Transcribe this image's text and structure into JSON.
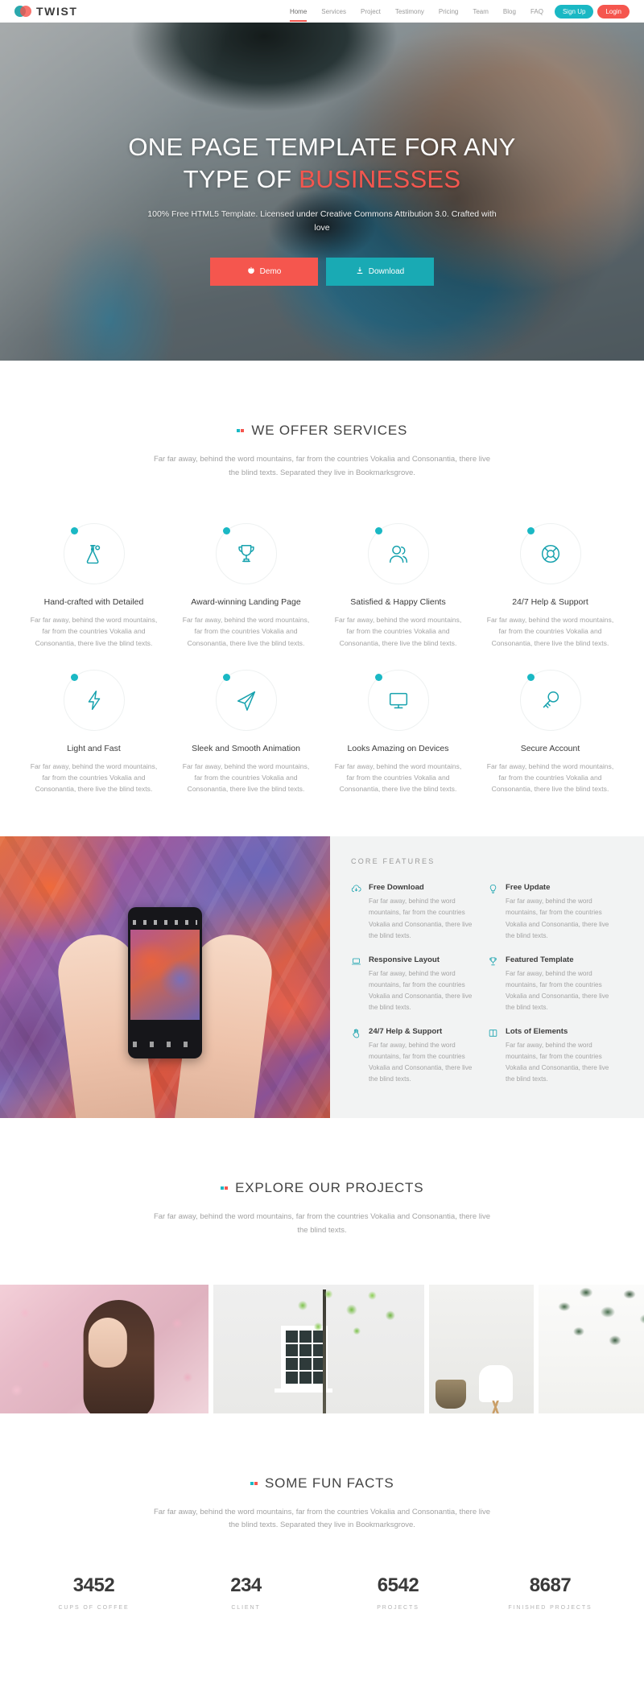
{
  "brand": {
    "name": "TWIST",
    "mark": "twist-logo-icon"
  },
  "nav": {
    "links": [
      {
        "label": "Home",
        "active": true
      },
      {
        "label": "Services",
        "active": false
      },
      {
        "label": "Project",
        "active": false
      },
      {
        "label": "Testimony",
        "active": false
      },
      {
        "label": "Pricing",
        "active": false
      },
      {
        "label": "Team",
        "active": false
      },
      {
        "label": "Blog",
        "active": false
      },
      {
        "label": "FAQ",
        "active": false
      }
    ],
    "signup_label": "Sign Up",
    "login_label": "Login"
  },
  "hero": {
    "title_line1": "ONE PAGE TEMPLATE FOR ANY",
    "title_line2_plain": "TYPE OF ",
    "title_line2_highlight": "BUSINESSES",
    "subtitle": "100% Free HTML5 Template. Licensed under Creative Commons Attribution 3.0. Crafted with love",
    "demo_label": "Demo",
    "download_label": "Download"
  },
  "services_section": {
    "title": "WE OFFER SERVICES",
    "description": "Far far away, behind the word mountains, far from the countries Vokalia and Consonantia, there live the blind texts. Separated they live in Bookmarksgrove.",
    "items": [
      {
        "icon": "flask-icon",
        "title": "Hand-crafted with Detailed",
        "desc": "Far far away, behind the word mountains, far from the countries Vokalia and Consonantia, there live the blind texts."
      },
      {
        "icon": "trophy-icon",
        "title": "Award-winning Landing Page",
        "desc": "Far far away, behind the word mountains, far from the countries Vokalia and Consonantia, there live the blind texts."
      },
      {
        "icon": "users-icon",
        "title": "Satisfied & Happy Clients",
        "desc": "Far far away, behind the word mountains, far from the countries Vokalia and Consonantia, there live the blind texts."
      },
      {
        "icon": "lifebuoy-icon",
        "title": "24/7 Help & Support",
        "desc": "Far far away, behind the word mountains, far from the countries Vokalia and Consonantia, there live the blind texts."
      },
      {
        "icon": "bolt-icon",
        "title": "Light and Fast",
        "desc": "Far far away, behind the word mountains, far from the countries Vokalia and Consonantia, there live the blind texts."
      },
      {
        "icon": "paper-plane-icon",
        "title": "Sleek and Smooth Animation",
        "desc": "Far far away, behind the word mountains, far from the countries Vokalia and Consonantia, there live the blind texts."
      },
      {
        "icon": "monitor-icon",
        "title": "Looks Amazing on Devices",
        "desc": "Far far away, behind the word mountains, far from the countries Vokalia and Consonantia, there live the blind texts."
      },
      {
        "icon": "key-icon",
        "title": "Secure Account",
        "desc": "Far far away, behind the word mountains, far from the countries Vokalia and Consonantia, there live the blind texts."
      }
    ]
  },
  "core_features": {
    "title": "CORE FEATURES",
    "image_alt": "hands-holding-phone-graffiti-photo",
    "items": [
      {
        "icon": "cloud-download-icon",
        "title": "Free Download",
        "desc": "Far far away, behind the word mountains, far from the countries Vokalia and Consonantia, there live the blind texts."
      },
      {
        "icon": "lightbulb-icon",
        "title": "Free Update",
        "desc": "Far far away, behind the word mountains, far from the countries Vokalia and Consonantia, there live the blind texts."
      },
      {
        "icon": "laptop-icon",
        "title": "Responsive Layout",
        "desc": "Far far away, behind the word mountains, far from the countries Vokalia and Consonantia, there live the blind texts."
      },
      {
        "icon": "trophy-icon",
        "title": "Featured Template",
        "desc": "Far far away, behind the word mountains, far from the countries Vokalia and Consonantia, there live the blind texts."
      },
      {
        "icon": "hand-icon",
        "title": "24/7 Help & Support",
        "desc": "Far far away, behind the word mountains, far from the countries Vokalia and Consonantia, there live the blind texts."
      },
      {
        "icon": "columns-icon",
        "title": "Lots of Elements",
        "desc": "Far far away, behind the word mountains, far from the countries Vokalia and Consonantia, there live the blind texts."
      }
    ]
  },
  "projects_section": {
    "title": "EXPLORE OUR PROJECTS",
    "description": "Far far away, behind the word mountains, far from the countries Vokalia and Consonantia, there live the blind texts.",
    "items": [
      {
        "alt": "woman-in-pink-blossoms-photo"
      },
      {
        "alt": "white-wall-window-tree-photo"
      },
      {
        "alt": "white-chair-and-basket-photo"
      },
      {
        "alt": "eucalyptus-branch-photo"
      }
    ]
  },
  "fun_facts": {
    "title": "SOME FUN FACTS",
    "description": "Far far away, behind the word mountains, far from the countries Vokalia and Consonantia, there live the blind texts. Separated they live in Bookmarksgrove.",
    "counters": [
      {
        "number": "3452",
        "label": "CUPS OF COFFEE"
      },
      {
        "number": "234",
        "label": "CLIENT"
      },
      {
        "number": "6542",
        "label": "PROJECTS"
      },
      {
        "number": "8687",
        "label": "FINISHED PROJECTS"
      }
    ]
  },
  "colors": {
    "teal": "#1ab8c4",
    "teal_dark": "#17a2ae",
    "coral": "#f5564e",
    "text_dark": "#3c3c3c",
    "text_muted": "#a4a4a4",
    "panel_bg": "#f2f3f3"
  }
}
